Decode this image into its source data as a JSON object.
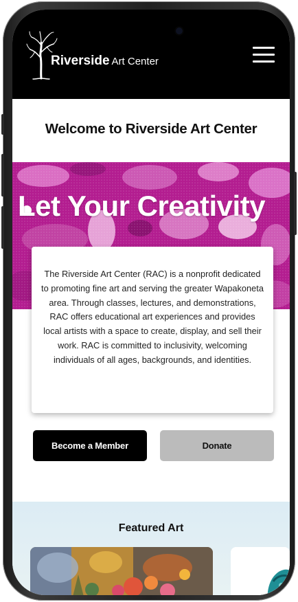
{
  "header": {
    "logo_bold": "Riverside",
    "logo_light": "Art Center",
    "menu_icon": "hamburger-menu-icon"
  },
  "main": {
    "welcome_heading": "Welcome to Riverside Art Center",
    "hero_headline": "Let Your Creativity",
    "about_text": "The Riverside Art Center (RAC) is a nonprofit dedicated to promoting fine art and serving the greater Wapakoneta area. Through classes, lectures, and demonstrations, RAC offers educational art experiences and provides local artists with a space to create, display, and sell their work. RAC is committed to inclusivity, welcoming individuals of all ages, backgrounds, and identities.",
    "buttons": {
      "member": "Become a Member",
      "donate": "Donate"
    }
  },
  "featured": {
    "title": "Featured Art"
  },
  "colors": {
    "header_bg": "#000000",
    "hero_magenta": "#b0208e",
    "member_button": "#000000",
    "donate_button": "#bbbbbb",
    "featured_bg": "#dcecf4"
  }
}
